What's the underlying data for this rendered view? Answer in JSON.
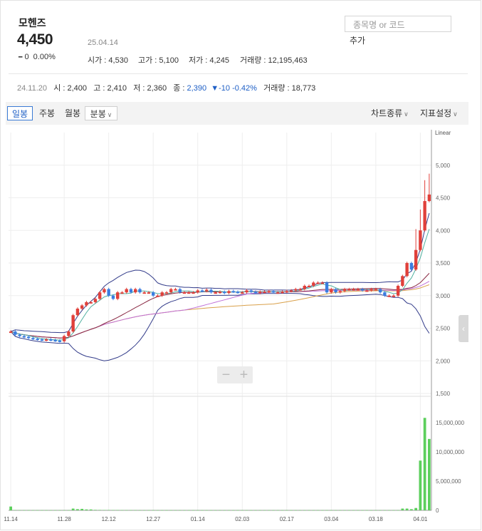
{
  "stock": {
    "name": "모헨즈",
    "price": "4,450",
    "date": "25.04.14",
    "change": "0",
    "change_pct": "0.00%",
    "change_mark": "━",
    "open_label": "시가",
    "open": "4,530",
    "high_label": "고가",
    "high": "5,100",
    "low_label": "저가",
    "low": "4,245",
    "volume_label": "거래량",
    "volume": "12,195,463"
  },
  "search": {
    "placeholder": "종목명 or 코드",
    "add_label": "추가"
  },
  "daily_info": {
    "date": "24.11.20",
    "open_label": "시",
    "open": "2,400",
    "high_label": "고",
    "high": "2,410",
    "low_label": "저",
    "low": "2,360",
    "close_label": "종",
    "close": "2,390",
    "change": "▼-10",
    "change_pct": "-0.42%",
    "volume_label": "거래량",
    "volume": "18,773"
  },
  "toolbar": {
    "tabs": [
      "일봉",
      "주봉",
      "월봉",
      "분봉"
    ],
    "chart_type": "차트종류",
    "indicator": "지표설정"
  },
  "colors": {
    "up": "#e0403a",
    "down": "#3a7de0",
    "volume": "#5ccf5c",
    "accent": "#1e5fc6"
  },
  "chart_data": {
    "type": "candlestick",
    "scale_label": "Linear",
    "price_axis": {
      "min": 1500,
      "max": 5500,
      "ticks": [
        "1,500",
        "2,000",
        "2,500",
        "3,000",
        "3,500",
        "4,000",
        "4,500",
        "5,000"
      ]
    },
    "volume_axis": {
      "min": 0,
      "max": 19000000,
      "ticks": [
        "0",
        "5,000,000",
        "10,000,000",
        "15,000,000"
      ]
    },
    "x_ticks": [
      "11.14",
      "11.28",
      "12.12",
      "12.27",
      "01.14",
      "02.03",
      "02.17",
      "03.04",
      "03.18",
      "04.01"
    ],
    "x_tick_index": [
      0,
      12,
      22,
      32,
      42,
      52,
      62,
      72,
      82,
      92
    ],
    "close": [
      2450,
      2400,
      2380,
      2370,
      2350,
      2340,
      2330,
      2320,
      2330,
      2320,
      2310,
      2300,
      2380,
      2450,
      2700,
      2800,
      2850,
      2900,
      2900,
      2950,
      3050,
      3100,
      3000,
      2950,
      3050,
      3050,
      3100,
      3050,
      3100,
      3050,
      3050,
      3050,
      3000,
      3000,
      3050,
      3050,
      3100,
      3100,
      3050,
      3050,
      3050,
      3050,
      3080,
      3070,
      3090,
      3050,
      3050,
      3060,
      3040,
      3070,
      3060,
      3050,
      3050,
      3080,
      3060,
      3040,
      3060,
      3060,
      3070,
      3050,
      3050,
      3060,
      3070,
      3080,
      3100,
      3100,
      3150,
      3150,
      3200,
      3200,
      3200,
      3050,
      3100,
      3050,
      3070,
      3100,
      3100,
      3100,
      3100,
      3080,
      3080,
      3100,
      3100,
      3050,
      3000,
      3000,
      3000,
      3150,
      3300,
      3500,
      3400,
      3700,
      4000,
      4450,
      4550
    ],
    "volume": [
      650000,
      50000,
      40000,
      30000,
      30000,
      30000,
      30000,
      30000,
      30000,
      30000,
      30000,
      30000,
      30000,
      30000,
      300000,
      200000,
      250000,
      150000,
      150000,
      80000,
      70000,
      60000,
      60000,
      50000,
      50000,
      40000,
      40000,
      40000,
      40000,
      30000,
      30000,
      30000,
      30000,
      30000,
      30000,
      30000,
      30000,
      30000,
      30000,
      30000,
      30000,
      30000,
      30000,
      30000,
      30000,
      30000,
      30000,
      30000,
      30000,
      30000,
      30000,
      30000,
      30000,
      30000,
      30000,
      30000,
      30000,
      30000,
      30000,
      30000,
      30000,
      30000,
      30000,
      30000,
      30000,
      30000,
      30000,
      30000,
      30000,
      30000,
      30000,
      30000,
      30000,
      30000,
      30000,
      30000,
      30000,
      30000,
      30000,
      30000,
      30000,
      30000,
      30000,
      30000,
      30000,
      30000,
      30000,
      30000,
      300000,
      300000,
      200000,
      400000,
      8500000,
      15800000,
      12200000
    ]
  }
}
